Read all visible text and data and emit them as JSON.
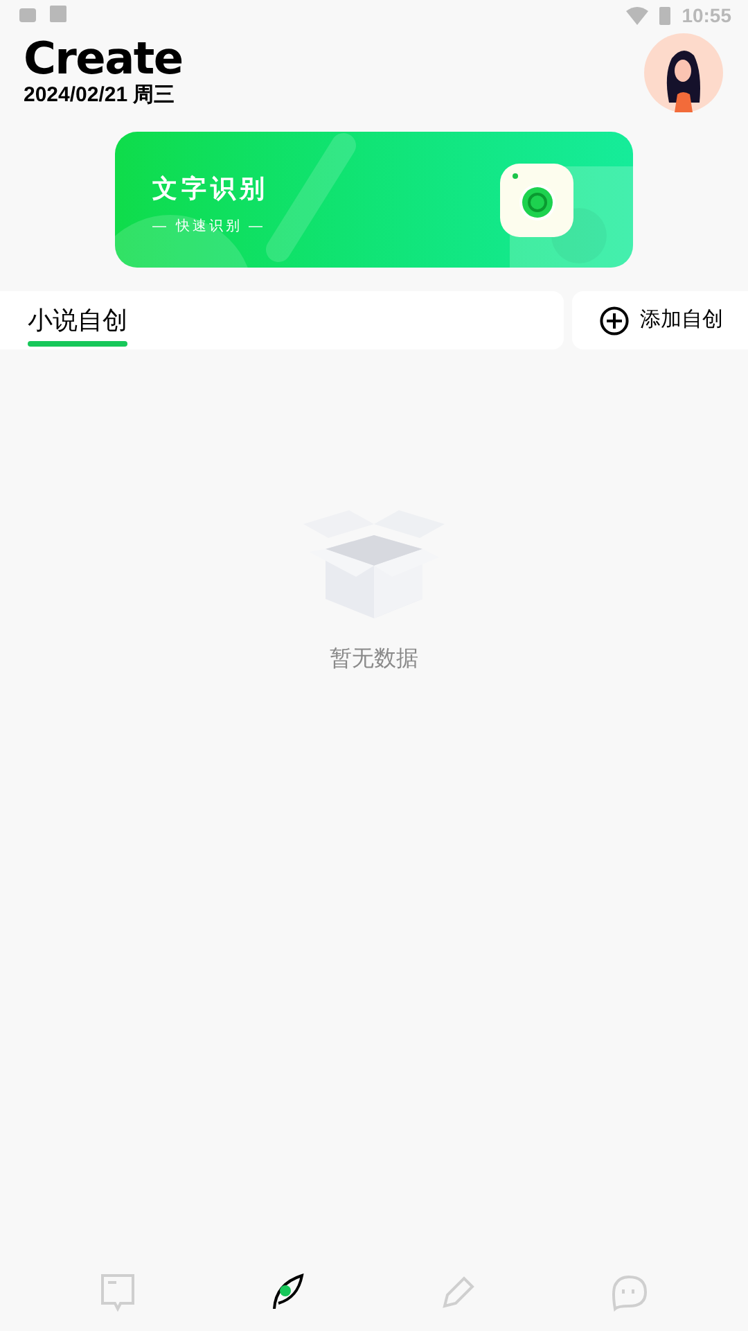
{
  "status_bar": {
    "time": "10:55"
  },
  "header": {
    "title": "Create",
    "date": "2024/02/21 周三"
  },
  "banner": {
    "title": "文字识别",
    "subtitle": "— 快速识别 —"
  },
  "tabs": [
    {
      "label": "小说自创",
      "selected": true
    }
  ],
  "add_button": {
    "label": "添加自创"
  },
  "empty_state": {
    "message": "暂无数据"
  },
  "bottom_nav": [
    {
      "kind": "book",
      "selected": false
    },
    {
      "kind": "feather",
      "selected": true
    },
    {
      "kind": "pen",
      "selected": false
    },
    {
      "kind": "bot",
      "selected": false
    }
  ]
}
